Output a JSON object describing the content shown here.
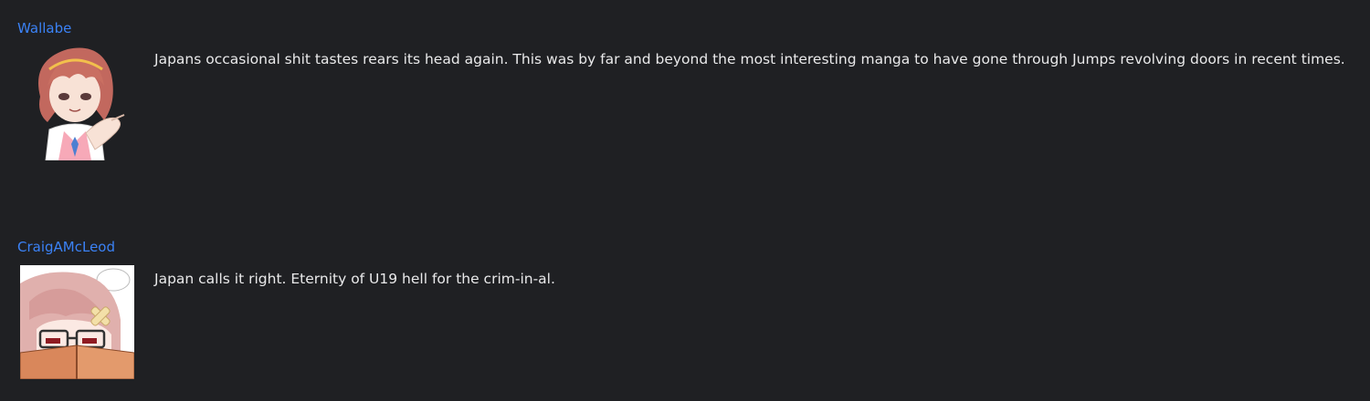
{
  "comments": [
    {
      "username": "Wallabe",
      "avatar_icon": "anime-girl-pointing-avatar-icon",
      "text": "Japans occasional shit tastes rears its head again. This was by far and beyond the most interesting manga to have gone through Jumps revolving doors in recent times."
    },
    {
      "username": "CraigAMcLeod",
      "avatar_icon": "anime-girl-reading-book-avatar-icon",
      "text": "Japan calls it right. Eternity of U19 hell for the crim-in-al."
    }
  ],
  "colors": {
    "background": "#1f2023",
    "username": "#3b82f6",
    "text": "#e9e9ea"
  }
}
